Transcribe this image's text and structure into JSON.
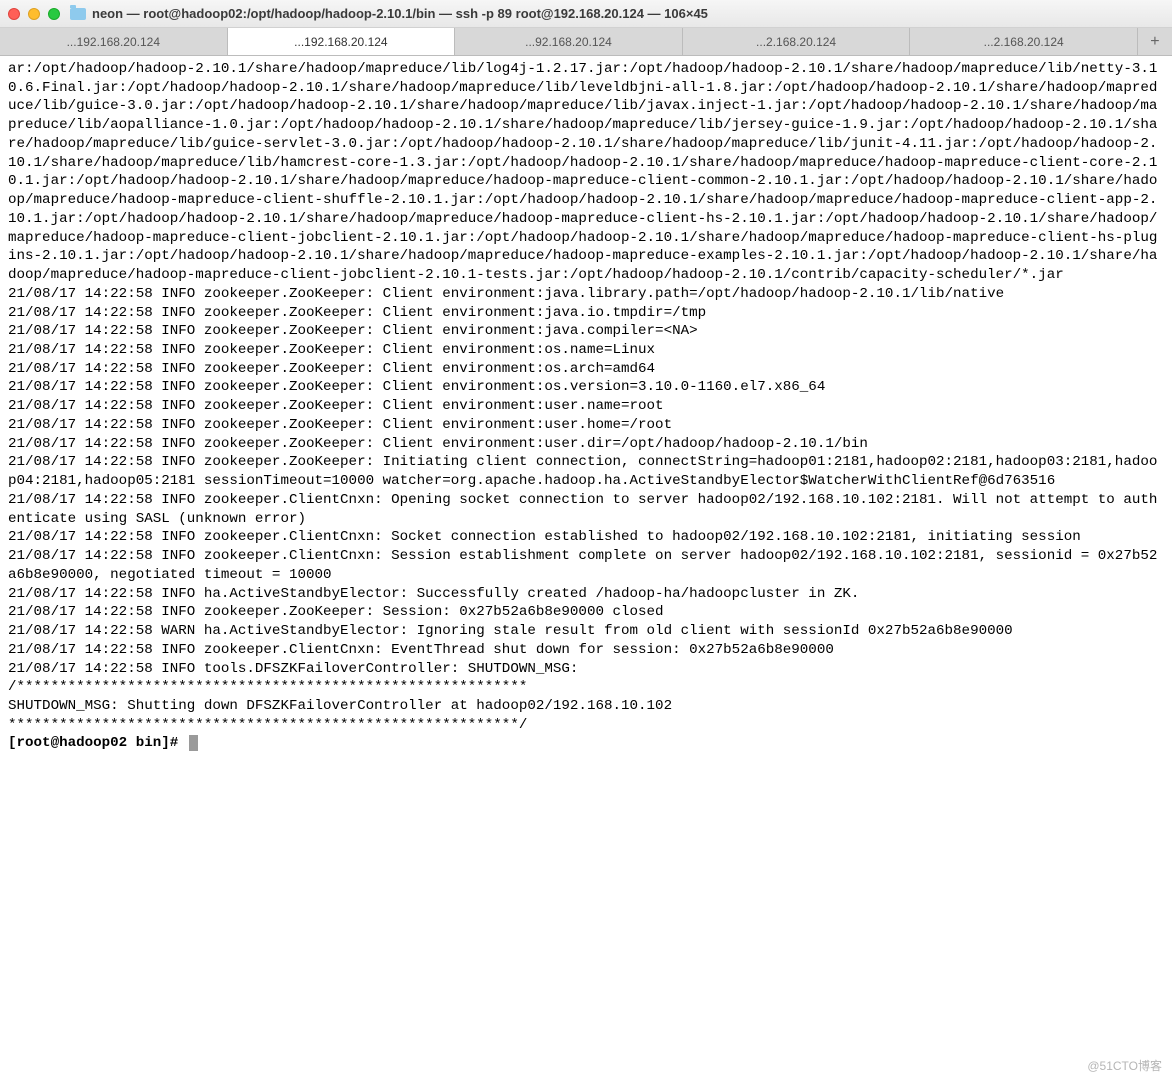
{
  "window": {
    "title": "neon — root@hadoop02:/opt/hadoop/hadoop-2.10.1/bin — ssh -p 89 root@192.168.20.124 — 106×45"
  },
  "tabs": {
    "items": [
      {
        "label": "...192.168.20.124",
        "active": false
      },
      {
        "label": "...192.168.20.124",
        "active": true
      },
      {
        "label": "...92.168.20.124",
        "active": false
      },
      {
        "label": "...2.168.20.124",
        "active": false
      },
      {
        "label": "...2.168.20.124",
        "active": false
      }
    ],
    "newtab": "+"
  },
  "terminal": {
    "classpath": "ar:/opt/hadoop/hadoop-2.10.1/share/hadoop/mapreduce/lib/log4j-1.2.17.jar:/opt/hadoop/hadoop-2.10.1/share/hadoop/mapreduce/lib/netty-3.10.6.Final.jar:/opt/hadoop/hadoop-2.10.1/share/hadoop/mapreduce/lib/leveldbjni-all-1.8.jar:/opt/hadoop/hadoop-2.10.1/share/hadoop/mapreduce/lib/guice-3.0.jar:/opt/hadoop/hadoop-2.10.1/share/hadoop/mapreduce/lib/javax.inject-1.jar:/opt/hadoop/hadoop-2.10.1/share/hadoop/mapreduce/lib/aopalliance-1.0.jar:/opt/hadoop/hadoop-2.10.1/share/hadoop/mapreduce/lib/jersey-guice-1.9.jar:/opt/hadoop/hadoop-2.10.1/share/hadoop/mapreduce/lib/guice-servlet-3.0.jar:/opt/hadoop/hadoop-2.10.1/share/hadoop/mapreduce/lib/junit-4.11.jar:/opt/hadoop/hadoop-2.10.1/share/hadoop/mapreduce/lib/hamcrest-core-1.3.jar:/opt/hadoop/hadoop-2.10.1/share/hadoop/mapreduce/hadoop-mapreduce-client-core-2.10.1.jar:/opt/hadoop/hadoop-2.10.1/share/hadoop/mapreduce/hadoop-mapreduce-client-common-2.10.1.jar:/opt/hadoop/hadoop-2.10.1/share/hadoop/mapreduce/hadoop-mapreduce-client-shuffle-2.10.1.jar:/opt/hadoop/hadoop-2.10.1/share/hadoop/mapreduce/hadoop-mapreduce-client-app-2.10.1.jar:/opt/hadoop/hadoop-2.10.1/share/hadoop/mapreduce/hadoop-mapreduce-client-hs-2.10.1.jar:/opt/hadoop/hadoop-2.10.1/share/hadoop/mapreduce/hadoop-mapreduce-client-jobclient-2.10.1.jar:/opt/hadoop/hadoop-2.10.1/share/hadoop/mapreduce/hadoop-mapreduce-client-hs-plugins-2.10.1.jar:/opt/hadoop/hadoop-2.10.1/share/hadoop/mapreduce/hadoop-mapreduce-examples-2.10.1.jar:/opt/hadoop/hadoop-2.10.1/share/hadoop/mapreduce/hadoop-mapreduce-client-jobclient-2.10.1-tests.jar:/opt/hadoop/hadoop-2.10.1/contrib/capacity-scheduler/*.jar",
    "log_lines": [
      "21/08/17 14:22:58 INFO zookeeper.ZooKeeper: Client environment:java.library.path=/opt/hadoop/hadoop-2.10.1/lib/native",
      "21/08/17 14:22:58 INFO zookeeper.ZooKeeper: Client environment:java.io.tmpdir=/tmp",
      "21/08/17 14:22:58 INFO zookeeper.ZooKeeper: Client environment:java.compiler=<NA>",
      "21/08/17 14:22:58 INFO zookeeper.ZooKeeper: Client environment:os.name=Linux",
      "21/08/17 14:22:58 INFO zookeeper.ZooKeeper: Client environment:os.arch=amd64",
      "21/08/17 14:22:58 INFO zookeeper.ZooKeeper: Client environment:os.version=3.10.0-1160.el7.x86_64",
      "21/08/17 14:22:58 INFO zookeeper.ZooKeeper: Client environment:user.name=root",
      "21/08/17 14:22:58 INFO zookeeper.ZooKeeper: Client environment:user.home=/root",
      "21/08/17 14:22:58 INFO zookeeper.ZooKeeper: Client environment:user.dir=/opt/hadoop/hadoop-2.10.1/bin",
      "21/08/17 14:22:58 INFO zookeeper.ZooKeeper: Initiating client connection, connectString=hadoop01:2181,hadoop02:2181,hadoop03:2181,hadoop04:2181,hadoop05:2181 sessionTimeout=10000 watcher=org.apache.hadoop.ha.ActiveStandbyElector$WatcherWithClientRef@6d763516",
      "21/08/17 14:22:58 INFO zookeeper.ClientCnxn: Opening socket connection to server hadoop02/192.168.10.102:2181. Will not attempt to authenticate using SASL (unknown error)",
      "21/08/17 14:22:58 INFO zookeeper.ClientCnxn: Socket connection established to hadoop02/192.168.10.102:2181, initiating session",
      "21/08/17 14:22:58 INFO zookeeper.ClientCnxn: Session establishment complete on server hadoop02/192.168.10.102:2181, sessionid = 0x27b52a6b8e90000, negotiated timeout = 10000",
      "21/08/17 14:22:58 INFO ha.ActiveStandbyElector: Successfully created /hadoop-ha/hadoopcluster in ZK.",
      "21/08/17 14:22:58 INFO zookeeper.ZooKeeper: Session: 0x27b52a6b8e90000 closed",
      "21/08/17 14:22:58 WARN ha.ActiveStandbyElector: Ignoring stale result from old client with sessionId 0x27b52a6b8e90000",
      "21/08/17 14:22:58 INFO zookeeper.ClientCnxn: EventThread shut down for session: 0x27b52a6b8e90000",
      "21/08/17 14:22:58 INFO tools.DFSZKFailoverController: SHUTDOWN_MSG:",
      "/************************************************************",
      "SHUTDOWN_MSG: Shutting down DFSZKFailoverController at hadoop02/192.168.10.102",
      "************************************************************/"
    ],
    "prompt": "[root@hadoop02 bin]# "
  },
  "watermark": "@51CTO博客"
}
